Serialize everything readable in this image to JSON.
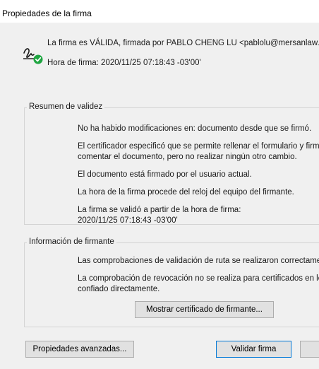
{
  "window": {
    "title": "Propiedades de la firma"
  },
  "signature": {
    "status_text": "La firma es VÁLIDA, firmada por PABLO CHENG LU <pablolu@mersanlaw.com>",
    "time_text": "Hora de firma: 2020/11/25 07:18:43 -03'00'"
  },
  "validity_summary": {
    "label": "Resumen de validez",
    "lines": [
      "No ha habido modificaciones en: documento desde que se firmó.",
      "El certificador especificó que se permite rellenar el formulario y firmar y",
      "comentar el documento, pero no realizar ningún otro cambio.",
      "El documento está firmado por el usuario actual.",
      "La hora de la firma procede del reloj del equipo del firmante.",
      "La firma se validó a partir de la hora de firma:",
      "2020/11/25 07:18:43 -03'00'"
    ]
  },
  "signer_info": {
    "label": "Información de firmante",
    "lines": [
      "Las comprobaciones de validación de ruta se realizaron correctamente.",
      "La comprobación de revocación no se realiza para certificados en los que se ha",
      "confiado directamente."
    ],
    "show_certificate_label": "Mostrar certificado de firmante..."
  },
  "footer": {
    "advanced_properties_label": "Propiedades avanzadas...",
    "validate_label": "Validar firma"
  },
  "colors": {
    "dialog_bg": "#f0f0f0",
    "title_bg": "#ffffff",
    "check_green": "#1fa541",
    "button_bg": "#e1e1e1",
    "default_button_border": "#0078d7"
  }
}
